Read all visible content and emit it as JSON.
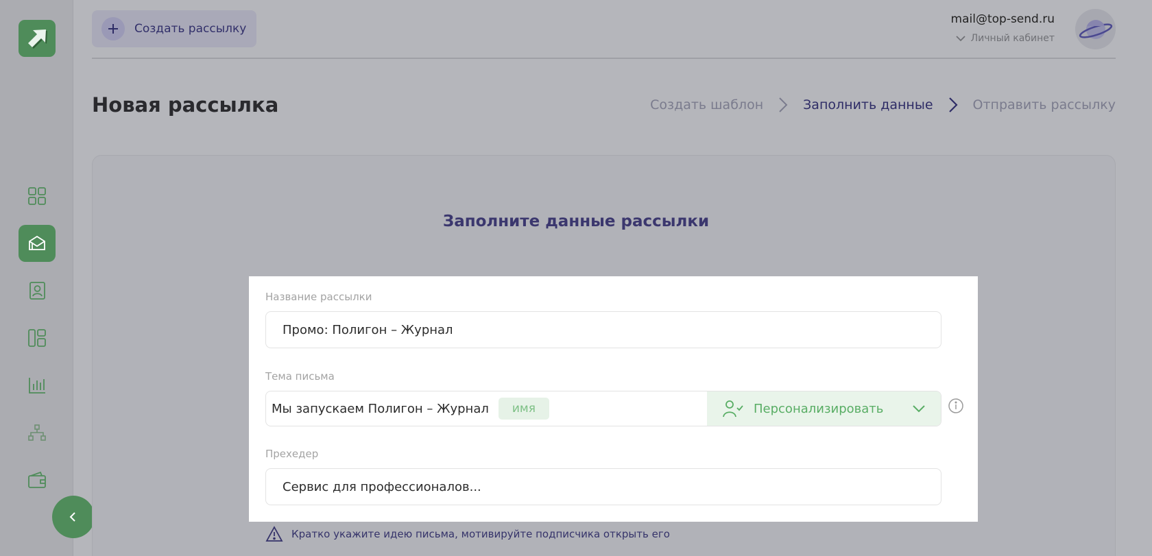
{
  "header": {
    "create_button_label": "Создать рассылку",
    "user_email": "mail@top-send.ru",
    "user_cabinet_label": "Личный кабинет"
  },
  "sidebar": {
    "items": [
      {
        "icon": "dashboard-grid-icon",
        "active": false
      },
      {
        "icon": "mail-campaign-icon",
        "active": true
      },
      {
        "icon": "contacts-book-icon",
        "active": false
      },
      {
        "icon": "templates-layout-icon",
        "active": false
      },
      {
        "icon": "statistics-chart-icon",
        "active": false
      },
      {
        "icon": "structure-tree-icon",
        "active": false
      },
      {
        "icon": "wallet-icon",
        "active": false
      }
    ]
  },
  "page": {
    "title": "Новая рассылка",
    "steps": [
      {
        "label": "Создать шаблон",
        "state": "done"
      },
      {
        "label": "Заполнить данные",
        "state": "current"
      },
      {
        "label": "Отправить рассылку",
        "state": "pending"
      }
    ]
  },
  "form": {
    "heading": "Заполните данные рассылки",
    "name_label": "Название рассылки",
    "name_value": "Промо: Полигон – Журнал",
    "subject_label": "Тема письма",
    "subject_value": "Мы запускаем Полигон – Журнал",
    "subject_tag": "имя",
    "personalize_label": "Персонализировать",
    "preheader_label": "Прехедер",
    "preheader_value": "Сервис для профессионалов...",
    "hint": "Кратко укажите идею письма, мотивируйте подписчика открыть его"
  },
  "colors": {
    "brand_green": "#4f8c5a",
    "accent_purple": "#3b376e",
    "personalize_green": "#58ad64",
    "overlay_gray": "#b5b6bb"
  }
}
